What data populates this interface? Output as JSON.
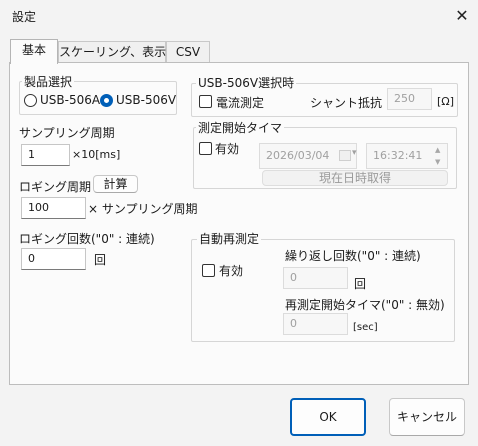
{
  "window": {
    "title": "設定",
    "close_glyph": "✕"
  },
  "tabs": [
    {
      "label": "基本"
    },
    {
      "label": "スケーリング、表示"
    },
    {
      "label": "CSV"
    }
  ],
  "product": {
    "legend": "製品選択",
    "options": [
      "USB-506A",
      "USB-506V"
    ],
    "selected": "USB-506V"
  },
  "usb506v": {
    "legend": "USB-506V選択時",
    "current_label": "電流測定",
    "shunt_label": "シャント抵抗",
    "shunt_value": "250",
    "shunt_unit": "[Ω]"
  },
  "sampling": {
    "label": "サンプリング周期",
    "value": "1",
    "unit": "×10[ms]"
  },
  "start_timer": {
    "legend": "測定開始タイマ",
    "enable_label": "有効",
    "date": "2026/03/04",
    "time": "16:32:41",
    "get_now_label": "現在日時取得",
    "spin_up": "▲",
    "spin_down": "▼",
    "calendar_glyph": "▾"
  },
  "logging_period": {
    "label": "ロギング周期",
    "calc_label": "計算",
    "value": "100",
    "unit": "× サンプリング周期"
  },
  "logging_count": {
    "label": "ロギング回数(\"0\" : 連続)",
    "value": "0",
    "unit": "回"
  },
  "auto_remeasure": {
    "legend": "自動再測定",
    "enable_label": "有効",
    "repeat_label": "繰り返し回数(\"0\" : 連続)",
    "repeat_value": "0",
    "repeat_unit": "回",
    "timer_label": "再測定開始タイマ(\"0\" : 無効)",
    "timer_value": "0",
    "timer_unit": "[sec]"
  },
  "footer": {
    "ok_label": "OK",
    "cancel_label": "キャンセル"
  }
}
